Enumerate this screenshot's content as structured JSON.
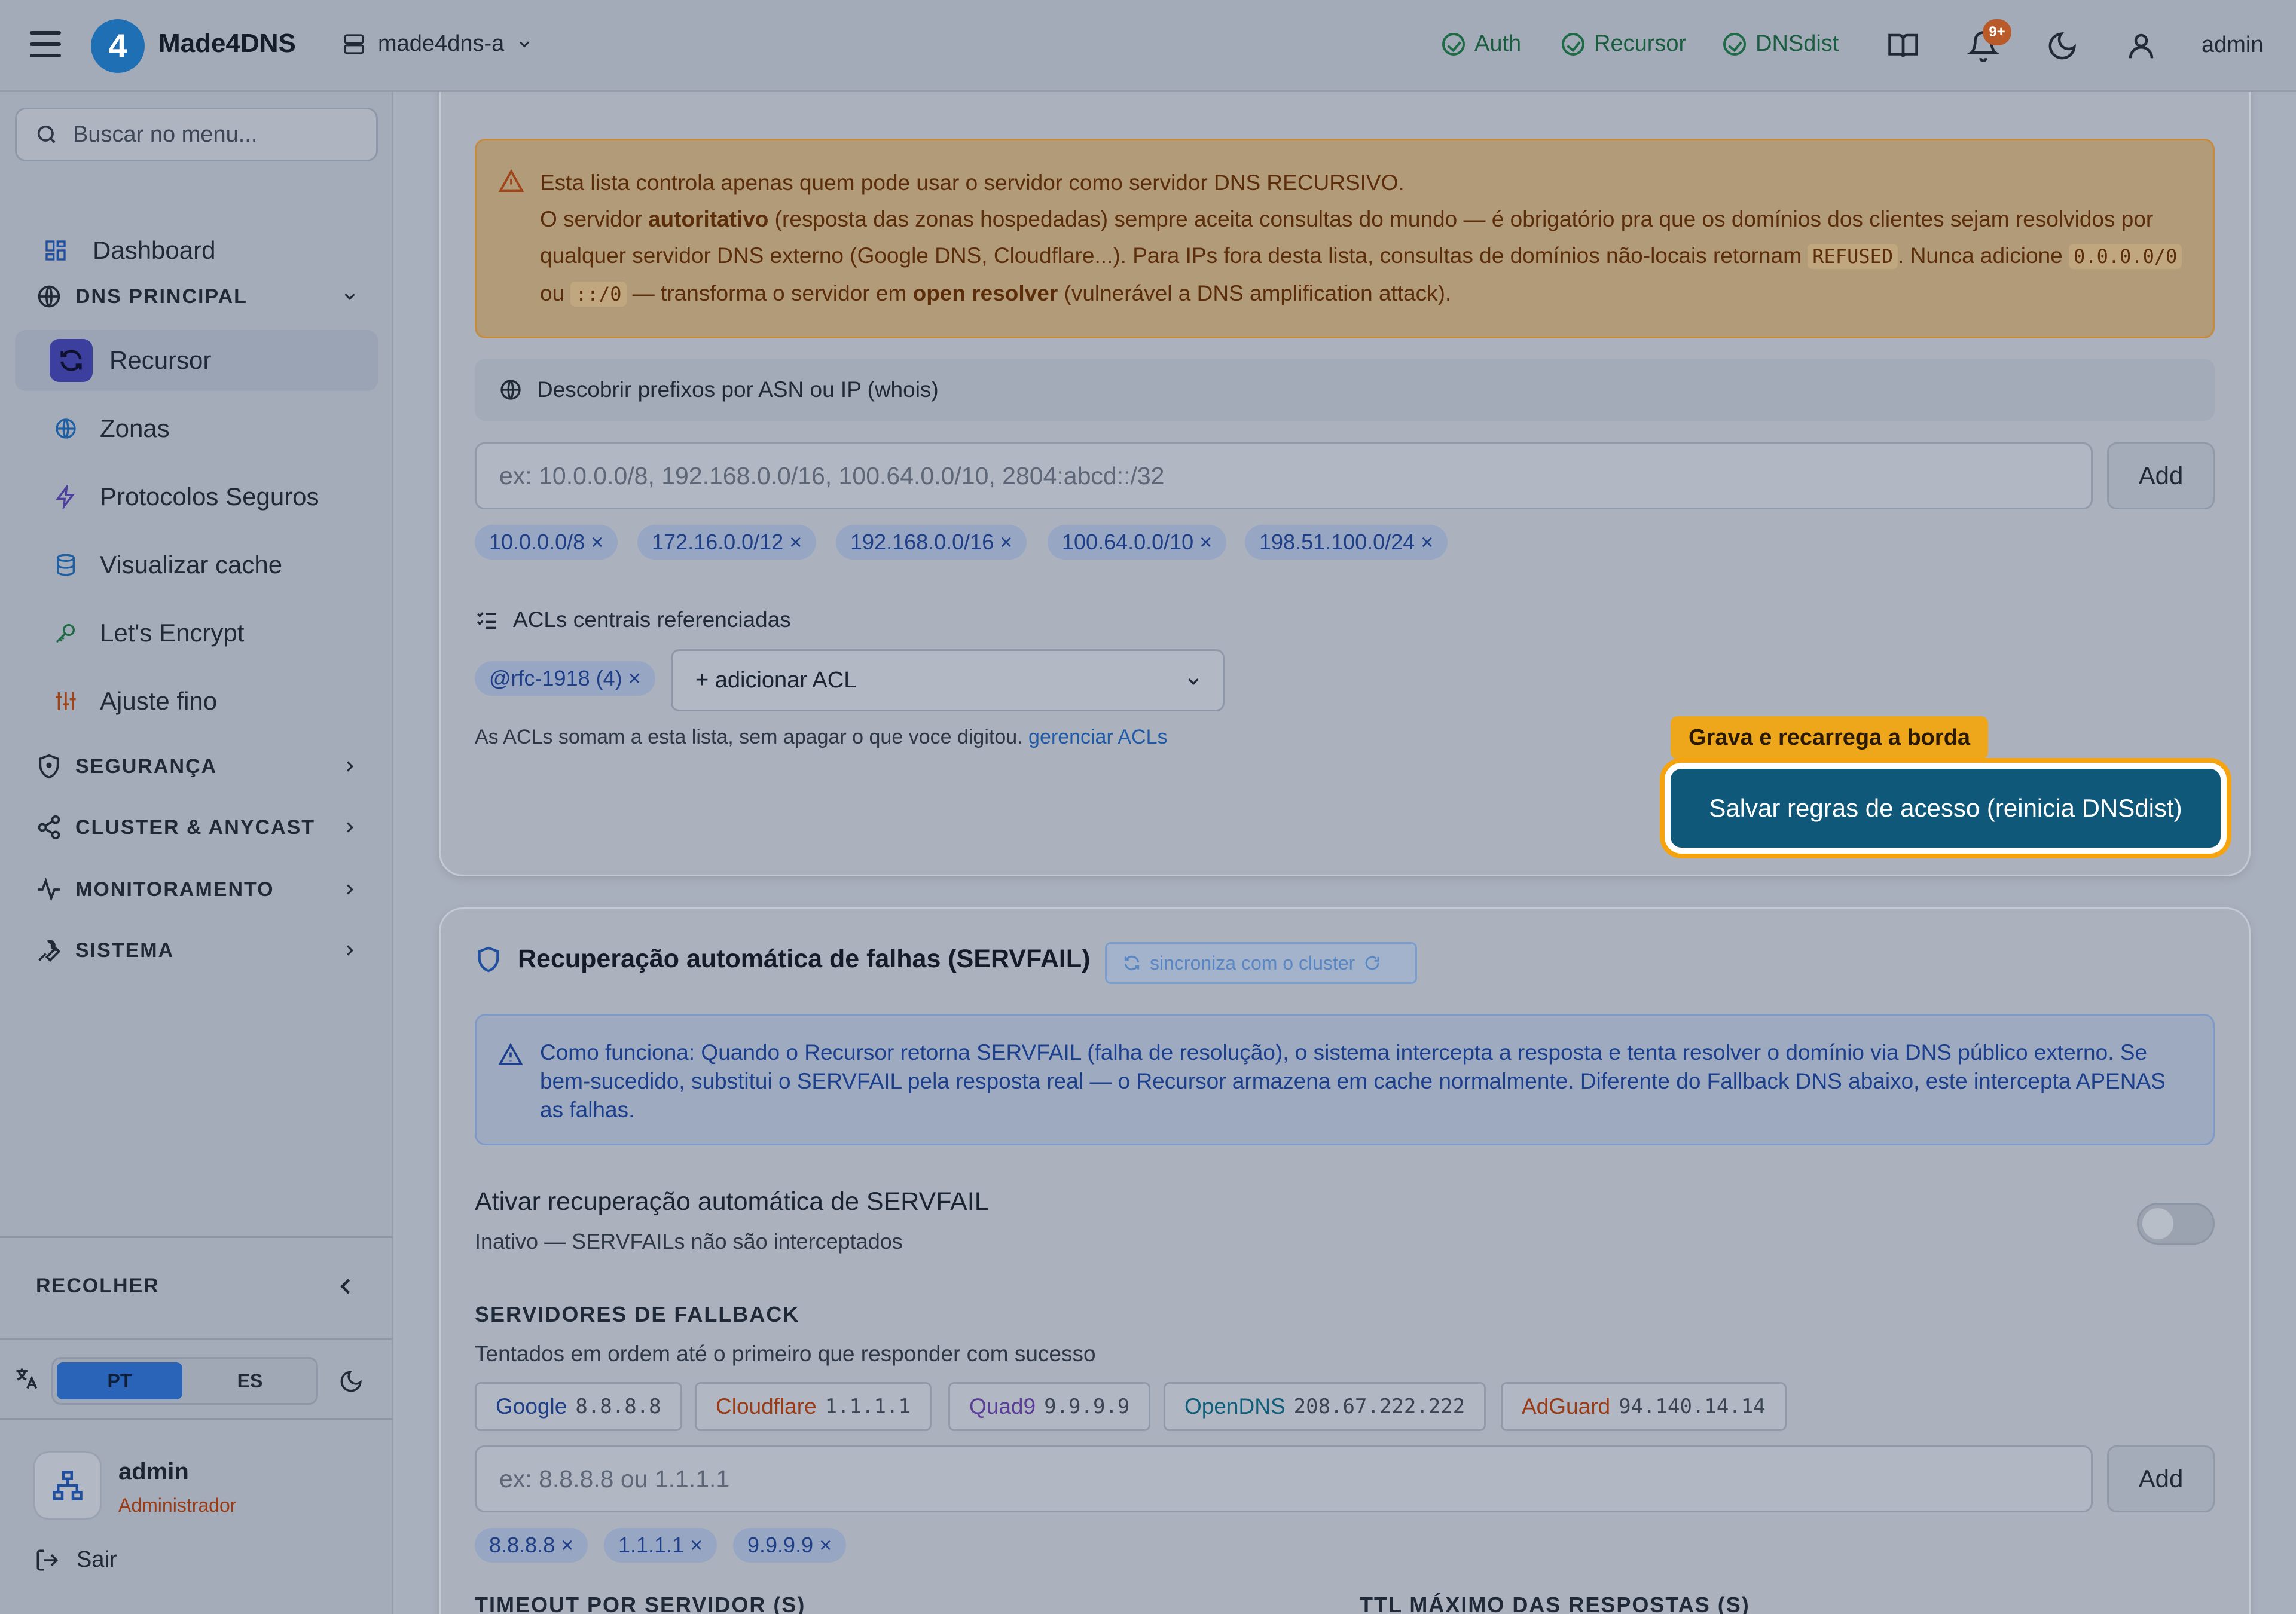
{
  "header": {
    "app_name": "Made4DNS",
    "server": "made4dns-a",
    "status": [
      {
        "label": "Auth",
        "color": "#1e6b46"
      },
      {
        "label": "Recursor",
        "color": "#1e6b46"
      },
      {
        "label": "DNSdist",
        "color": "#1e6b46"
      }
    ],
    "notifications_badge": "9+",
    "user": "admin"
  },
  "sidebar": {
    "search_placeholder": "Buscar no menu...",
    "dashboard": "Dashboard",
    "sections": [
      {
        "label": "DNS PRINCIPAL",
        "expanded": true
      },
      {
        "label": "SEGURANÇA",
        "expanded": false
      },
      {
        "label": "CLUSTER & ANYCAST",
        "expanded": false
      },
      {
        "label": "MONITORAMENTO",
        "expanded": false
      },
      {
        "label": "SISTEMA",
        "expanded": false
      }
    ],
    "items": [
      {
        "label": "Recursor",
        "icon": "refresh-icon",
        "active": true
      },
      {
        "label": "Zonas",
        "icon": "globe-icon"
      },
      {
        "label": "Protocolos Seguros",
        "icon": "bolt-icon"
      },
      {
        "label": "Visualizar cache",
        "icon": "database-icon"
      },
      {
        "label": "Let's Encrypt",
        "icon": "key-icon"
      },
      {
        "label": "Ajuste fino",
        "icon": "sliders-icon"
      }
    ],
    "collapse": "RECOLHER",
    "languages": [
      {
        "label": "PT",
        "active": true
      },
      {
        "label": "ES",
        "active": false
      }
    ],
    "user": {
      "name": "admin",
      "role": "Administrador"
    },
    "logout": "Sair"
  },
  "access_card": {
    "warning": {
      "line1": "Esta lista controla apenas quem pode usar o servidor como servidor DNS RECURSIVO.",
      "p2_a": "O servidor ",
      "p2_bold": "autoritativo",
      "p2_b": " (resposta das zonas hospedadas) sempre aceita consultas do mundo — é obrigatório pra que os domínios dos clientes sejam resolvidos por qualquer servidor DNS externo (Google DNS, Cloudflare...). Para IPs fora desta lista, consultas de domínios não-locais retornam ",
      "p2_code": "REFUSED",
      "p2_c": ". Nunca adicione ",
      "p2_code2": "0.0.0.0/0",
      "p2_d": " ou ",
      "p2_code3": "::/0",
      "p2_e": " — transforma o servidor em ",
      "p2_bold2": "open resolver",
      "p2_f": " (vulnerável a DNS amplification attack)."
    },
    "asn_lookup": "Descobrir prefixos por ASN ou IP (whois)",
    "prefix_placeholder": "ex: 10.0.0.0/8, 192.168.0.0/16, 100.64.0.0/10, 2804:abcd::/32",
    "add_label": "Add",
    "prefixes": [
      "10.0.0.0/8 ×",
      "172.16.0.0/12 ×",
      "192.168.0.0/16 ×",
      "100.64.0.0/10 ×",
      "198.51.100.0/24 ×"
    ],
    "acl_heading": "ACLs centrais referenciadas",
    "acl_chip": "@rfc-1918 (4) ×",
    "acl_select": "+ adicionar ACL",
    "acl_note": "As ACLs somam a esta lista, sem apagar o que voce digitou.",
    "acl_link": "gerenciar ACLs",
    "tooltip": "Grava e recarrega a borda",
    "save_label": "Salvar regras de acesso (reinicia DNSdist)"
  },
  "servfail_card": {
    "title": "Recuperação automática de falhas (SERVFAIL)",
    "sync_badge": "sincroniza com o cluster",
    "info": "Como funciona: Quando o Recursor retorna SERVFAIL (falha de resolução), o sistema intercepta a resposta e tenta resolver o domínio via DNS público externo. Se bem-sucedido, substitui o SERVFAIL pela resposta real — o Recursor armazena em cache normalmente. Diferente do Fallback DNS abaixo, este intercepta APENAS as falhas.",
    "toggle_title": "Ativar recuperação automática de SERVFAIL",
    "toggle_sub": "Inativo — SERVFAILs não são interceptados",
    "toggle_on": false,
    "fallback_label": "SERVIDORES DE FALLBACK",
    "fallback_sub": "Tentados em ordem até o primeiro que responder com sucesso",
    "servers": [
      {
        "name": "Google",
        "ip": "8.8.8.8",
        "color": "#1e3f88"
      },
      {
        "name": "Cloudflare",
        "ip": "1.1.1.1",
        "color": "#9a3b15"
      },
      {
        "name": "Quad9",
        "ip": "9.9.9.9",
        "color": "#5a3d96"
      },
      {
        "name": "OpenDNS",
        "ip": "208.67.222.222",
        "color": "#0f5e7a"
      },
      {
        "name": "AdGuard",
        "ip": "94.140.14.14",
        "color": "#9a3b15"
      }
    ],
    "server_placeholder": "ex: 8.8.8.8 ou 1.1.1.1",
    "add_label": "Add",
    "selected": [
      "8.8.8.8 ×",
      "1.1.1.1 ×",
      "9.9.9.9 ×"
    ],
    "timeout_label": "TIMEOUT POR SERVIDOR (S)",
    "ttl_label": "TTL MÁXIMO DAS RESPOSTAS (S)"
  }
}
